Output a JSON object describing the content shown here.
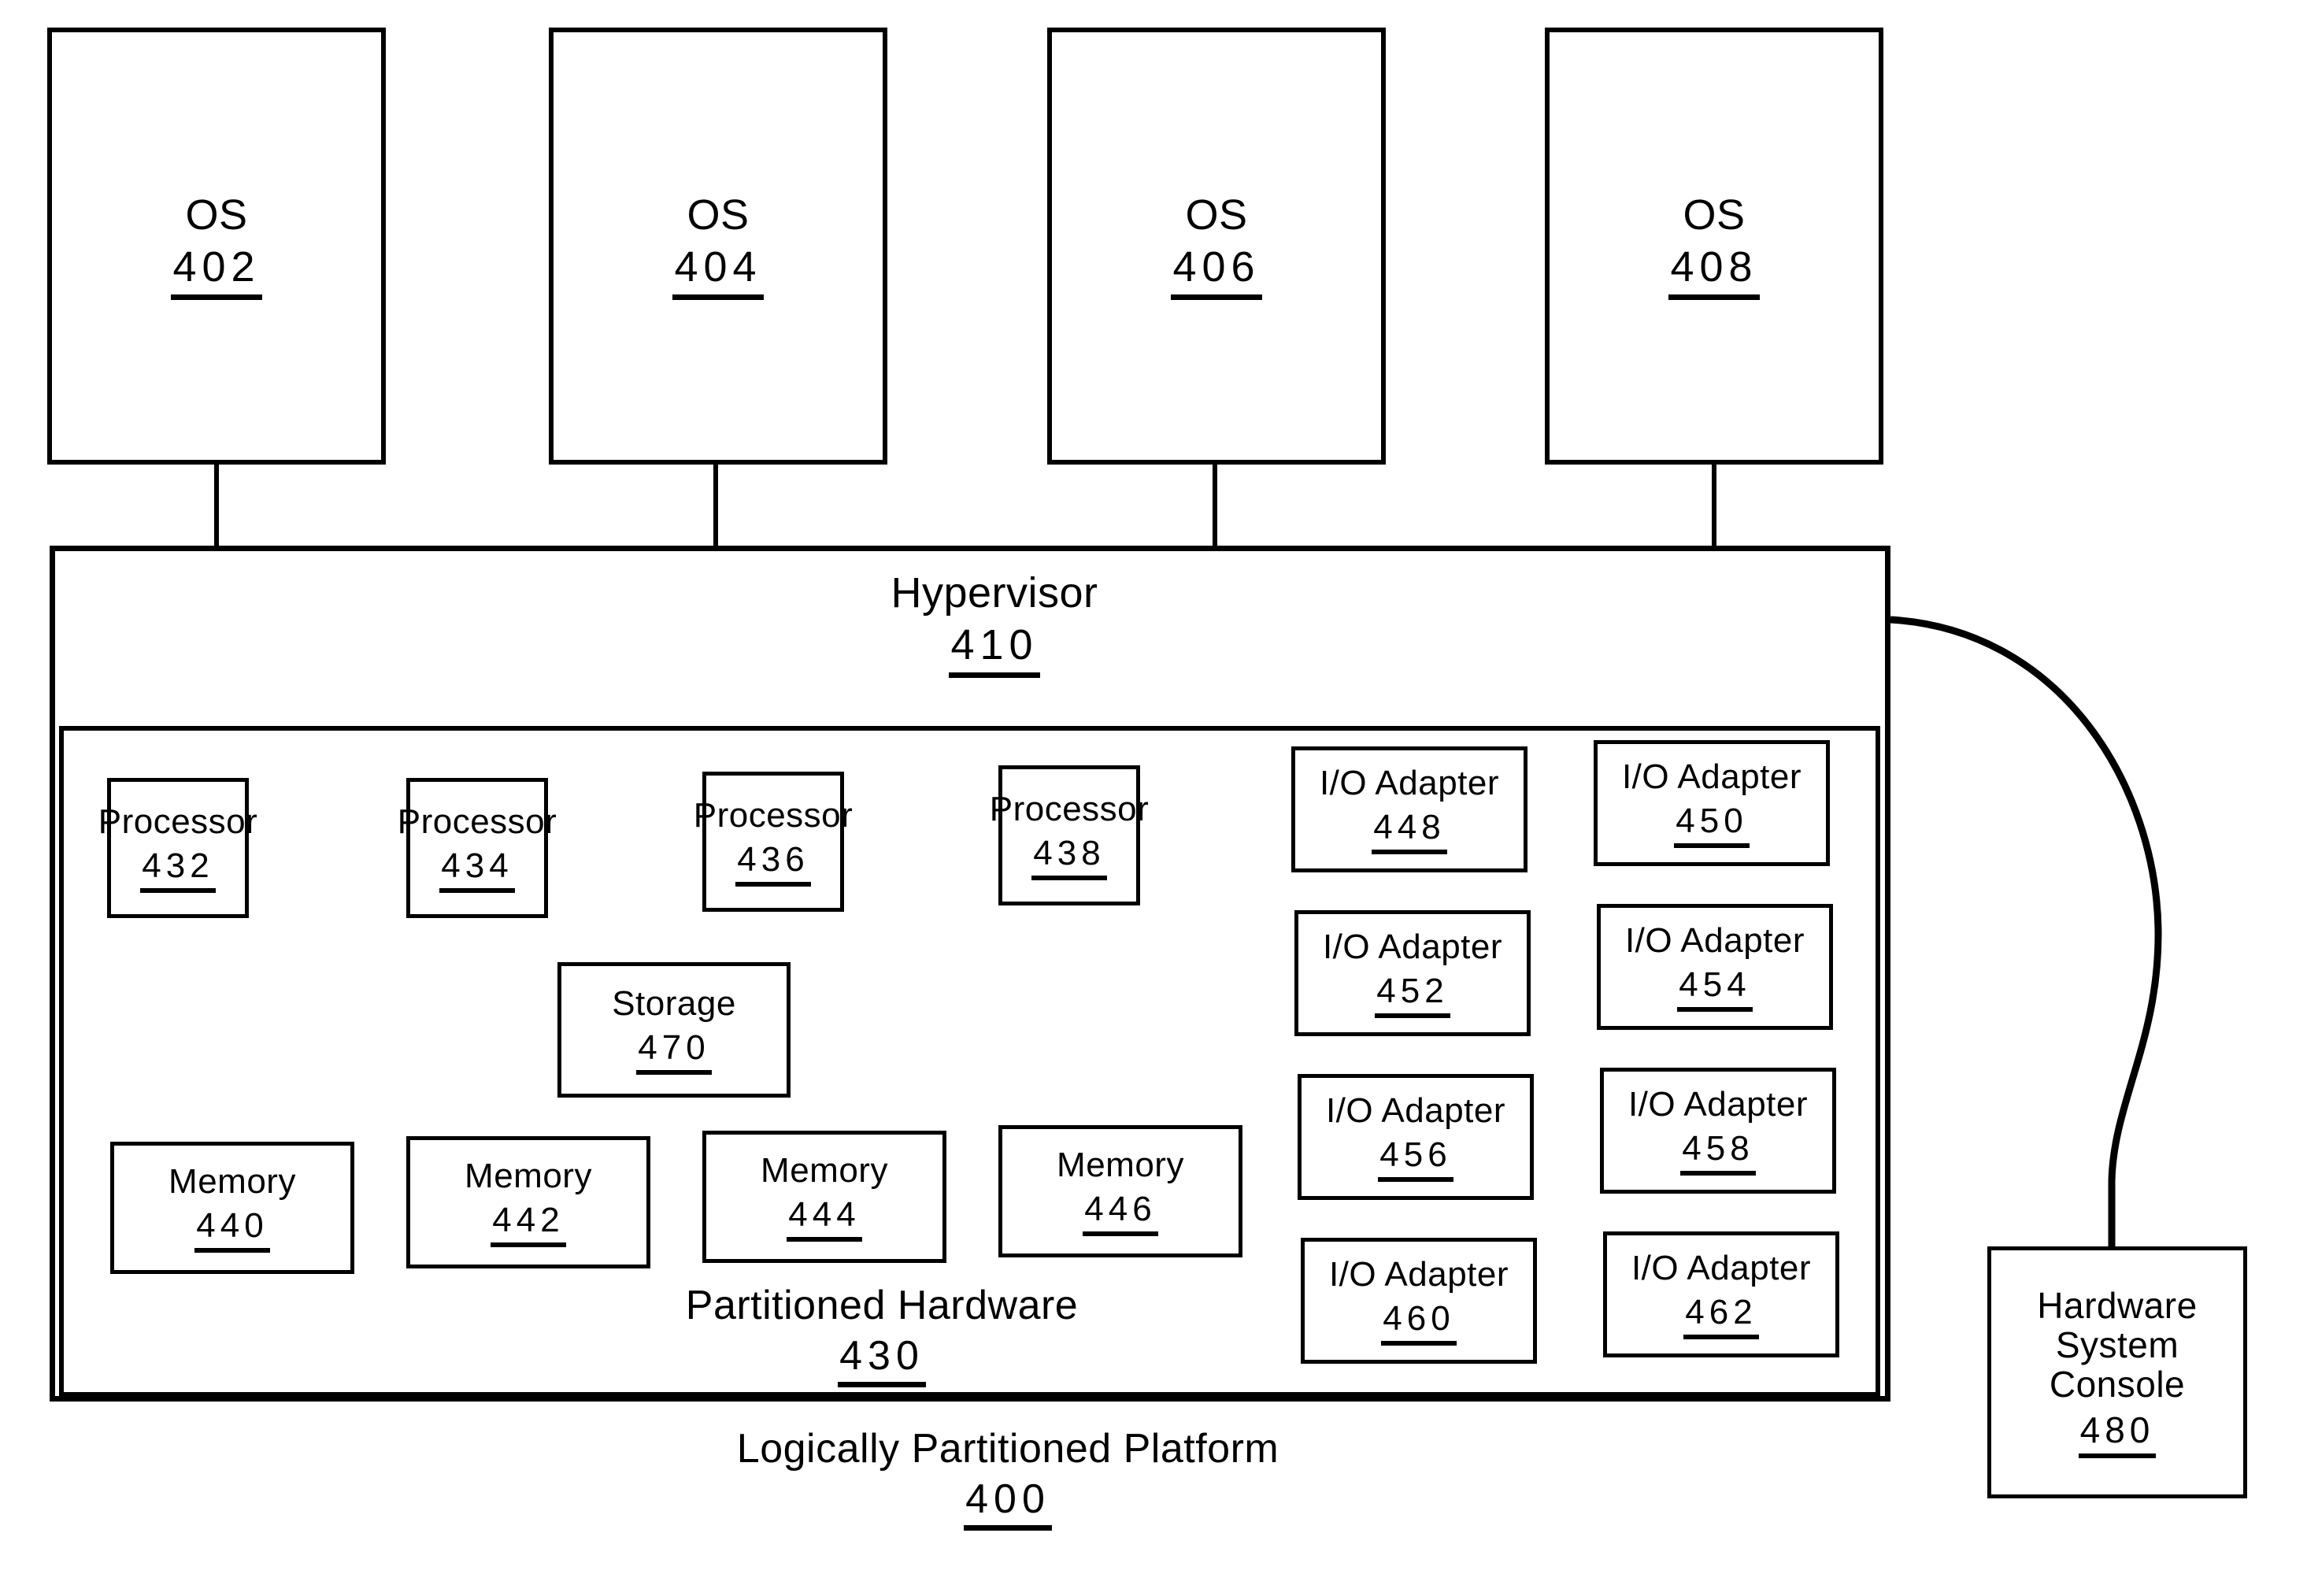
{
  "figure": {
    "title": "Logically Partitioned Platform",
    "platform_ref": "400"
  },
  "operating_systems": [
    {
      "label": "OS",
      "ref": "402"
    },
    {
      "label": "OS",
      "ref": "404"
    },
    {
      "label": "OS",
      "ref": "406"
    },
    {
      "label": "OS",
      "ref": "408"
    }
  ],
  "hypervisor": {
    "label": "Hypervisor",
    "ref": "410"
  },
  "partitioned_hardware": {
    "label": "Partitioned Hardware",
    "ref": "430",
    "processors": [
      {
        "label": "Processor",
        "ref": "432"
      },
      {
        "label": "Processor",
        "ref": "434"
      },
      {
        "label": "Processor",
        "ref": "436"
      },
      {
        "label": "Processor",
        "ref": "438"
      }
    ],
    "storage": {
      "label": "Storage",
      "ref": "470"
    },
    "memories": [
      {
        "label": "Memory",
        "ref": "440"
      },
      {
        "label": "Memory",
        "ref": "442"
      },
      {
        "label": "Memory",
        "ref": "444"
      },
      {
        "label": "Memory",
        "ref": "446"
      }
    ],
    "io_adapters": [
      {
        "label": "I/O Adapter",
        "ref": "448"
      },
      {
        "label": "I/O Adapter",
        "ref": "450"
      },
      {
        "label": "I/O Adapter",
        "ref": "452"
      },
      {
        "label": "I/O Adapter",
        "ref": "454"
      },
      {
        "label": "I/O Adapter",
        "ref": "456"
      },
      {
        "label": "I/O Adapter",
        "ref": "458"
      },
      {
        "label": "I/O Adapter",
        "ref": "460"
      },
      {
        "label": "I/O Adapter",
        "ref": "462"
      }
    ]
  },
  "console": {
    "line1": "Hardware",
    "line2": "System",
    "line3": "Console",
    "ref": "480"
  },
  "colors": {
    "stroke": "#000000",
    "background": "#ffffff"
  }
}
